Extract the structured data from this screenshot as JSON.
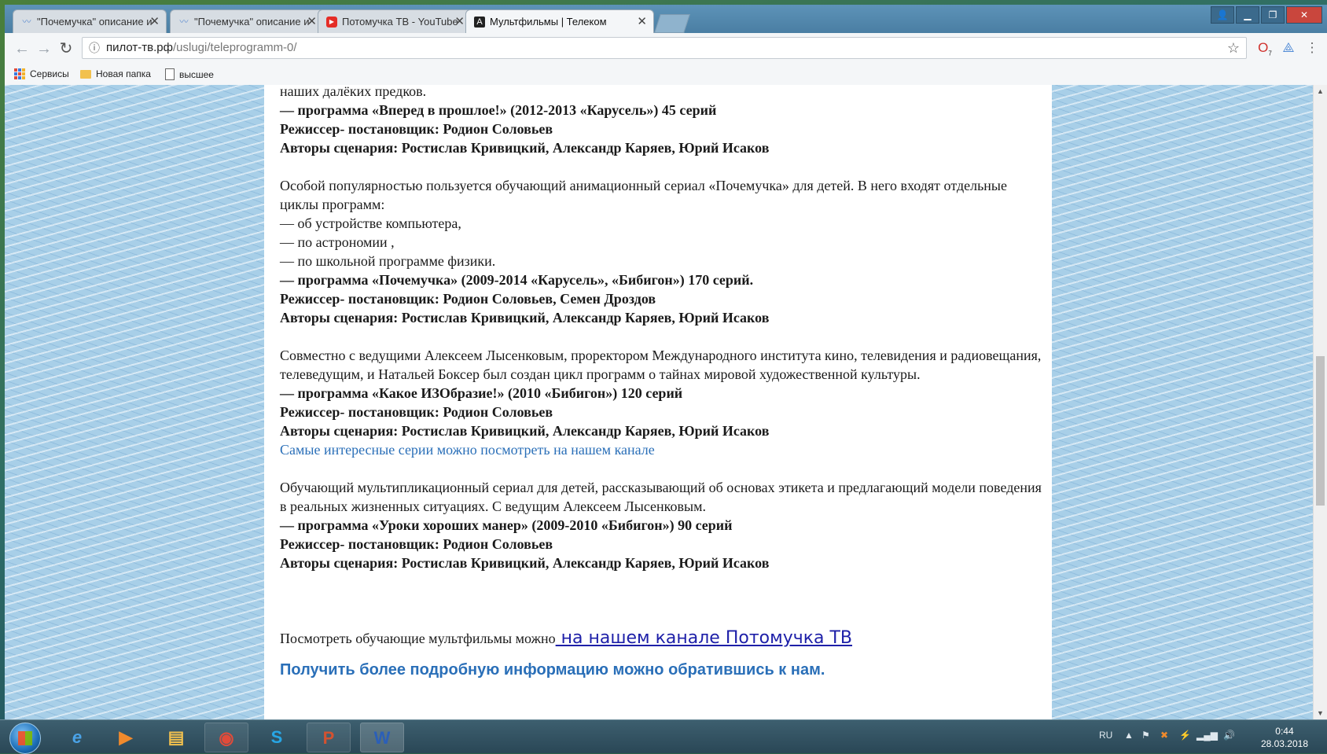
{
  "browser": {
    "tabs": [
      {
        "title": "\"Почемучка\" описание и",
        "favicon": "wave-icon",
        "active": false
      },
      {
        "title": "\"Почемучка\" описание и",
        "favicon": "wave-icon",
        "active": false
      },
      {
        "title": "Потомучка ТВ - YouTube",
        "favicon": "youtube-icon",
        "active": false
      },
      {
        "title": "Мультфильмы | Телеком",
        "favicon": "site-icon",
        "active": true
      }
    ],
    "address": {
      "host": "пилот-тв.рф",
      "path": "/uslugi/teleprogramm-0/"
    },
    "extension_badge": "7",
    "bookmarks": [
      {
        "label": "Сервисы",
        "icon": "apps-icon"
      },
      {
        "label": "Новая папка",
        "icon": "folder-icon"
      },
      {
        "label": "высшее",
        "icon": "page-icon"
      }
    ]
  },
  "content": {
    "section1": {
      "intro_tail": "наших далёких предков.",
      "program": "— программа «Вперед в прошлое!» (2012-2013 «Карусель») 45 серий",
      "director": "Режиссер- постановщик: Родион Соловьев",
      "authors": "Авторы сценария: Ростислав Кривицкий, Александр Каряев, Юрий Исаков"
    },
    "section2": {
      "intro": "Особой популярностью пользуется обучающий анимационный сериал «Почемучка» для детей. В него входят отдельные циклы программ:",
      "items": [
        "— об устройстве компьютера,",
        "— по астрономии ,",
        "— по школьной программе физики."
      ],
      "program": "— программа «Почемучка» (2009-2014 «Карусель», «Бибигон») 170 серий.",
      "director": "Режиссер- постановщик: Родион Соловьев, Семен Дроздов",
      "authors": "Авторы сценария: Ростислав Кривицкий, Александр Каряев, Юрий Исаков"
    },
    "section3": {
      "intro": "Совместно с ведущими Алексеем Лысенковым, проректором Международного института кино, телевидения и радиовещания, телеведущим, и Натальей Боксер был создан цикл программ о тайнах мировой художественной культуры.",
      "program": "— программа «Какое ИЗОбразие!» (2010 «Бибигон») 120 серий",
      "director": "Режиссер- постановщик: Родион Соловьев",
      "authors": "Авторы сценария: Ростислав Кривицкий, Александр Каряев, Юрий Исаков",
      "link": "Самые интересные серии можно посмотреть на нашем канале"
    },
    "section4": {
      "intro": "Обучающий мультипликационный сериал для детей, рассказывающий об основах этикета и предлагающий модели поведения в реальных жизненных ситуациях. С ведущим Алексеем Лысенковым.",
      "program": "— программа «Уроки хороших манер» (2009-2010 «Бибигон») 90 серий",
      "director": "Режиссер- постановщик: Родион Соловьев",
      "authors": "Авторы сценария: Ростислав Кривицкий, Александр Каряев, Юрий Исаков"
    },
    "watch_text": "Посмотреть обучающие мультфильмы можно",
    "watch_link": " на нашем канале Потомучка ТВ ",
    "cta": "Получить более подробную информацию можно обратившись к нам."
  },
  "taskbar": {
    "apps": [
      "ie-icon",
      "media-player-icon",
      "explorer-icon",
      "chrome-icon",
      "skype-icon",
      "powerpoint-icon",
      "word-icon"
    ],
    "lang": "RU",
    "time": "0:44",
    "date": "28.03.2018"
  }
}
